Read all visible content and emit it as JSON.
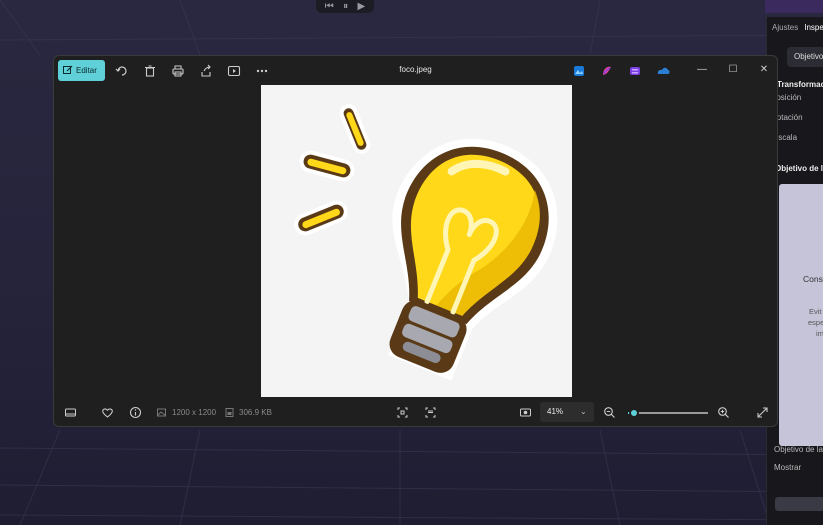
{
  "media_controls": {
    "prev_icon": "⏮",
    "pause_icon": "⏸",
    "play_icon": "▶"
  },
  "inspector": {
    "tabs": [
      "Ajustes",
      "Inspe"
    ],
    "chip_label": "Objetivo",
    "rows": {
      "transform": "Transformacio",
      "position": "Posición",
      "rotation": "Rotación",
      "scale": "Escala",
      "objective_header": "Objetivo de la",
      "card_title": "Cons",
      "card_line1": "Evit",
      "card_line2": "espe",
      "card_line3": "im",
      "objective_footer": "Objetivo de la",
      "show": "Mostrar"
    }
  },
  "window": {
    "title": "foco.jpeg",
    "edit_label": "Editar",
    "minimize": "—",
    "maximize": "☐",
    "close": "✕",
    "image_dimensions": "1200 x 1200",
    "file_size": "306.9 KB",
    "zoom_level": "41%",
    "zoom_fraction": 0.08,
    "accent": "#5fd0d8",
    "bulb_yellow": "#ffd81a",
    "bulb_outline": "#5a3a16"
  }
}
